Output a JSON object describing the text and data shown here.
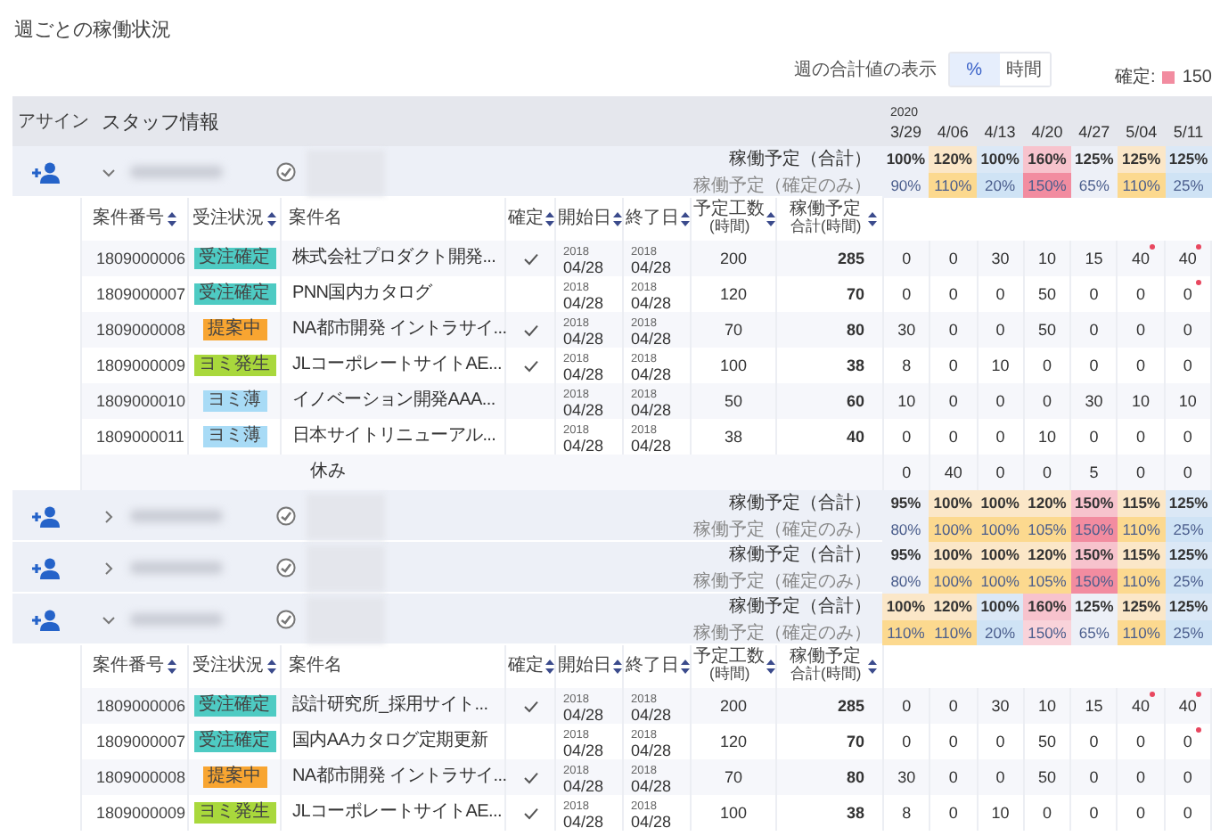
{
  "title": "週ごとの稼働状況",
  "display_toggle": {
    "label": "週の合計値の表示",
    "options": [
      {
        "label": "%",
        "selected": true
      },
      {
        "label": "時間",
        "selected": false
      }
    ]
  },
  "legend": {
    "label": "確定:",
    "color": "#f28ca0",
    "value": "150"
  },
  "header": {
    "assign": "アサイン",
    "staff": "スタッフ情報",
    "weeks": [
      {
        "year": "2020",
        "date": "3/29"
      },
      {
        "date": "4/06"
      },
      {
        "date": "4/13"
      },
      {
        "date": "4/20"
      },
      {
        "date": "4/27"
      },
      {
        "date": "5/04"
      },
      {
        "date": "5/11"
      }
    ]
  },
  "staff": [
    {
      "expanded": true,
      "total_label": "稼働予定（合計）",
      "confirmed_label": "稼働予定（確定のみ）",
      "total": [
        {
          "value": "100%",
          "color": "#edf0f7"
        },
        {
          "value": "120%",
          "color": "#fbe7c8"
        },
        {
          "value": "100%",
          "color": "#dbe8f6"
        },
        {
          "value": "160%",
          "color": "#f7c3cd"
        },
        {
          "value": "125%",
          "color": "#edf0f7"
        },
        {
          "value": "125%",
          "color": "#fbe7c8"
        },
        {
          "value": "125%",
          "color": "#dbe8f6"
        }
      ],
      "confirmed": [
        {
          "value": "90%",
          "color": "#edf0f7"
        },
        {
          "value": "110%",
          "color": "#fcd98f"
        },
        {
          "value": "20%",
          "color": "#cfe3f5"
        },
        {
          "value": "150%",
          "color": "#f28ca0"
        },
        {
          "value": "65%",
          "color": "#edf0f7"
        },
        {
          "value": "110%",
          "color": "#fcd98f"
        },
        {
          "value": "25%",
          "color": "#cfe3f5"
        }
      ],
      "projects": {
        "columns": [
          {
            "label": "案件番号",
            "sortable": true
          },
          {
            "label": "受注状況",
            "sortable": true
          },
          {
            "label": "案件名",
            "sortable": false
          },
          {
            "label": "確定",
            "sortable": true
          },
          {
            "label": "開始日",
            "sortable": true
          },
          {
            "label": "終了日",
            "sortable": true
          },
          {
            "label": "予定工数",
            "sublabel": "(時間)",
            "sortable": true
          },
          {
            "label": "稼働予定",
            "sublabel": "合計(時間)",
            "sortable": true
          }
        ],
        "rows": [
          {
            "number": "1809000006",
            "status": {
              "label": "受注確定",
              "color": "#4ecbc3"
            },
            "name": "株式会社プロダクト開発...",
            "confirmed": true,
            "start": {
              "year": "2018",
              "date": "04/28"
            },
            "end": {
              "year": "2018",
              "date": "04/28"
            },
            "planned": "200",
            "total": "285",
            "weeks": [
              {
                "value": "0",
                "marked": false
              },
              {
                "value": "0",
                "marked": false
              },
              {
                "value": "30",
                "marked": false
              },
              {
                "value": "10",
                "marked": false
              },
              {
                "value": "15",
                "marked": false
              },
              {
                "value": "40",
                "marked": true
              },
              {
                "value": "40",
                "marked": true
              }
            ]
          },
          {
            "number": "1809000007",
            "status": {
              "label": "受注確定",
              "color": "#4ecbc3"
            },
            "name": "PNN国内カタログ",
            "confirmed": false,
            "start": {
              "year": "2018",
              "date": "04/28"
            },
            "end": {
              "year": "2018",
              "date": "04/28"
            },
            "planned": "120",
            "total": "70",
            "weeks": [
              {
                "value": "0",
                "marked": false
              },
              {
                "value": "0",
                "marked": false
              },
              {
                "value": "0",
                "marked": false
              },
              {
                "value": "50",
                "marked": false
              },
              {
                "value": "0",
                "marked": false
              },
              {
                "value": "0",
                "marked": false
              },
              {
                "value": "0",
                "marked": true
              }
            ]
          },
          {
            "number": "1809000008",
            "status": {
              "label": "提案中",
              "color": "#f8a531"
            },
            "name": "NA都市開発 イントラサイ...",
            "confirmed": true,
            "start": {
              "year": "2018",
              "date": "04/28"
            },
            "end": {
              "year": "2018",
              "date": "04/28"
            },
            "planned": "70",
            "total": "80",
            "weeks": [
              {
                "value": "30",
                "marked": false
              },
              {
                "value": "0",
                "marked": false
              },
              {
                "value": "0",
                "marked": false
              },
              {
                "value": "50",
                "marked": false
              },
              {
                "value": "0",
                "marked": false
              },
              {
                "value": "0",
                "marked": false
              },
              {
                "value": "0",
                "marked": false
              }
            ]
          },
          {
            "number": "1809000009",
            "status": {
              "label": "ヨミ発生",
              "color": "#a9d83c"
            },
            "name": "JLコーポレートサイトAE...",
            "confirmed": true,
            "start": {
              "year": "2018",
              "date": "04/28"
            },
            "end": {
              "year": "2018",
              "date": "04/28"
            },
            "planned": "100",
            "total": "38",
            "weeks": [
              {
                "value": "8",
                "marked": false
              },
              {
                "value": "0",
                "marked": false
              },
              {
                "value": "10",
                "marked": false
              },
              {
                "value": "0",
                "marked": false
              },
              {
                "value": "0",
                "marked": false
              },
              {
                "value": "0",
                "marked": false
              },
              {
                "value": "0",
                "marked": false
              }
            ]
          },
          {
            "number": "1809000010",
            "status": {
              "label": "ヨミ薄",
              "color": "#a8dbf6"
            },
            "name": "イノベーション開発AAA...",
            "confirmed": false,
            "start": {
              "year": "2018",
              "date": "04/28"
            },
            "end": {
              "year": "2018",
              "date": "04/28"
            },
            "planned": "50",
            "total": "60",
            "weeks": [
              {
                "value": "10",
                "marked": false
              },
              {
                "value": "0",
                "marked": false
              },
              {
                "value": "0",
                "marked": false
              },
              {
                "value": "0",
                "marked": false
              },
              {
                "value": "30",
                "marked": false
              },
              {
                "value": "10",
                "marked": false
              },
              {
                "value": "10",
                "marked": false
              }
            ]
          },
          {
            "number": "1809000011",
            "status": {
              "label": "ヨミ薄",
              "color": "#a8dbf6"
            },
            "name": "日本サイトリニューアル...",
            "confirmed": false,
            "start": {
              "year": "2018",
              "date": "04/28"
            },
            "end": {
              "year": "2018",
              "date": "04/28"
            },
            "planned": "38",
            "total": "40",
            "weeks": [
              {
                "value": "0",
                "marked": false
              },
              {
                "value": "0",
                "marked": false
              },
              {
                "value": "0",
                "marked": false
              },
              {
                "value": "10",
                "marked": false
              },
              {
                "value": "0",
                "marked": false
              },
              {
                "value": "0",
                "marked": false
              },
              {
                "value": "0",
                "marked": false
              }
            ]
          }
        ],
        "leave": {
          "label": "休み",
          "weeks": [
            "0",
            "40",
            "0",
            "0",
            "5",
            "0",
            "0"
          ]
        }
      }
    },
    {
      "expanded": false,
      "total_label": "稼働予定（合計）",
      "confirmed_label": "稼働予定（確定のみ）",
      "total": [
        {
          "value": "95%",
          "color": "#edf0f7"
        },
        {
          "value": "100%",
          "color": "#fbe7c8"
        },
        {
          "value": "100%",
          "color": "#fbe7c8"
        },
        {
          "value": "120%",
          "color": "#fbe7c8"
        },
        {
          "value": "150%",
          "color": "#f7c3cd"
        },
        {
          "value": "115%",
          "color": "#fbe7c8"
        },
        {
          "value": "125%",
          "color": "#dbe8f6"
        }
      ],
      "confirmed": [
        {
          "value": "80%",
          "color": "#edf0f7"
        },
        {
          "value": "100%",
          "color": "#fcd98f"
        },
        {
          "value": "100%",
          "color": "#fcd98f"
        },
        {
          "value": "105%",
          "color": "#fcd98f"
        },
        {
          "value": "150%",
          "color": "#f28ca0"
        },
        {
          "value": "110%",
          "color": "#fcd98f"
        },
        {
          "value": "25%",
          "color": "#cfe3f5"
        }
      ]
    },
    {
      "expanded": false,
      "total_label": "稼働予定（合計）",
      "confirmed_label": "稼働予定（確定のみ）",
      "total": [
        {
          "value": "95%",
          "color": "#edf0f7"
        },
        {
          "value": "100%",
          "color": "#fbe7c8"
        },
        {
          "value": "100%",
          "color": "#fbe7c8"
        },
        {
          "value": "120%",
          "color": "#fbe7c8"
        },
        {
          "value": "150%",
          "color": "#f7c3cd"
        },
        {
          "value": "115%",
          "color": "#fbe7c8"
        },
        {
          "value": "125%",
          "color": "#dbe8f6"
        }
      ],
      "confirmed": [
        {
          "value": "80%",
          "color": "#edf0f7"
        },
        {
          "value": "100%",
          "color": "#fcd98f"
        },
        {
          "value": "100%",
          "color": "#fcd98f"
        },
        {
          "value": "105%",
          "color": "#fcd98f"
        },
        {
          "value": "150%",
          "color": "#f28ca0"
        },
        {
          "value": "110%",
          "color": "#fcd98f"
        },
        {
          "value": "25%",
          "color": "#cfe3f5"
        }
      ]
    },
    {
      "expanded": true,
      "total_label": "稼働予定（合計）",
      "confirmed_label": "稼働予定（確定のみ）",
      "total": [
        {
          "value": "100%",
          "color": "#fbe7c8"
        },
        {
          "value": "120%",
          "color": "#fbe7c8"
        },
        {
          "value": "100%",
          "color": "#dbe8f6"
        },
        {
          "value": "160%",
          "color": "#f7c3cd"
        },
        {
          "value": "125%",
          "color": "#edf0f7"
        },
        {
          "value": "125%",
          "color": "#fbe7c8"
        },
        {
          "value": "125%",
          "color": "#dbe8f6"
        }
      ],
      "confirmed": [
        {
          "value": "110%",
          "color": "#fcd98f"
        },
        {
          "value": "110%",
          "color": "#fcd98f"
        },
        {
          "value": "20%",
          "color": "#cfe3f5"
        },
        {
          "value": "150%",
          "color": "#f9d3da"
        },
        {
          "value": "65%",
          "color": "#edf0f7"
        },
        {
          "value": "110%",
          "color": "#fcd98f"
        },
        {
          "value": "25%",
          "color": "#cfe3f5"
        }
      ],
      "projects": {
        "columns": [
          {
            "label": "案件番号",
            "sortable": true
          },
          {
            "label": "受注状況",
            "sortable": true
          },
          {
            "label": "案件名",
            "sortable": false
          },
          {
            "label": "確定",
            "sortable": true
          },
          {
            "label": "開始日",
            "sortable": true
          },
          {
            "label": "終了日",
            "sortable": true
          },
          {
            "label": "予定工数",
            "sublabel": "(時間)",
            "sortable": true
          },
          {
            "label": "稼働予定",
            "sublabel": "合計(時間)",
            "sortable": true
          }
        ],
        "rows": [
          {
            "number": "1809000006",
            "status": {
              "label": "受注確定",
              "color": "#4ecbc3"
            },
            "name": "設計研究所_採用サイト...",
            "confirmed": true,
            "start": {
              "year": "2018",
              "date": "04/28"
            },
            "end": {
              "year": "2018",
              "date": "04/28"
            },
            "planned": "200",
            "total": "285",
            "weeks": [
              {
                "value": "0",
                "marked": false
              },
              {
                "value": "0",
                "marked": false
              },
              {
                "value": "30",
                "marked": false
              },
              {
                "value": "10",
                "marked": false
              },
              {
                "value": "15",
                "marked": false
              },
              {
                "value": "40",
                "marked": true
              },
              {
                "value": "40",
                "marked": true
              }
            ]
          },
          {
            "number": "1809000007",
            "status": {
              "label": "受注確定",
              "color": "#4ecbc3"
            },
            "name": "国内AAカタログ定期更新",
            "confirmed": false,
            "start": {
              "year": "2018",
              "date": "04/28"
            },
            "end": {
              "year": "2018",
              "date": "04/28"
            },
            "planned": "120",
            "total": "70",
            "weeks": [
              {
                "value": "0",
                "marked": false
              },
              {
                "value": "0",
                "marked": false
              },
              {
                "value": "0",
                "marked": false
              },
              {
                "value": "50",
                "marked": false
              },
              {
                "value": "0",
                "marked": false
              },
              {
                "value": "0",
                "marked": false
              },
              {
                "value": "0",
                "marked": true
              }
            ]
          },
          {
            "number": "1809000008",
            "status": {
              "label": "提案中",
              "color": "#f8a531"
            },
            "name": "NA都市開発 イントラサイ...",
            "confirmed": true,
            "start": {
              "year": "2018",
              "date": "04/28"
            },
            "end": {
              "year": "2018",
              "date": "04/28"
            },
            "planned": "70",
            "total": "80",
            "weeks": [
              {
                "value": "30",
                "marked": false
              },
              {
                "value": "0",
                "marked": false
              },
              {
                "value": "0",
                "marked": false
              },
              {
                "value": "50",
                "marked": false
              },
              {
                "value": "0",
                "marked": false
              },
              {
                "value": "0",
                "marked": false
              },
              {
                "value": "0",
                "marked": false
              }
            ]
          },
          {
            "number": "1809000009",
            "status": {
              "label": "ヨミ発生",
              "color": "#a9d83c"
            },
            "name": "JLコーポレートサイトAE...",
            "confirmed": true,
            "start": {
              "year": "2018",
              "date": "04/28"
            },
            "end": {
              "year": "2018",
              "date": "04/28"
            },
            "planned": "100",
            "total": "38",
            "weeks": [
              {
                "value": "8",
                "marked": false
              },
              {
                "value": "0",
                "marked": false
              },
              {
                "value": "10",
                "marked": false
              },
              {
                "value": "0",
                "marked": false
              },
              {
                "value": "0",
                "marked": false
              },
              {
                "value": "0",
                "marked": false
              },
              {
                "value": "0",
                "marked": false
              }
            ]
          }
        ]
      }
    }
  ]
}
